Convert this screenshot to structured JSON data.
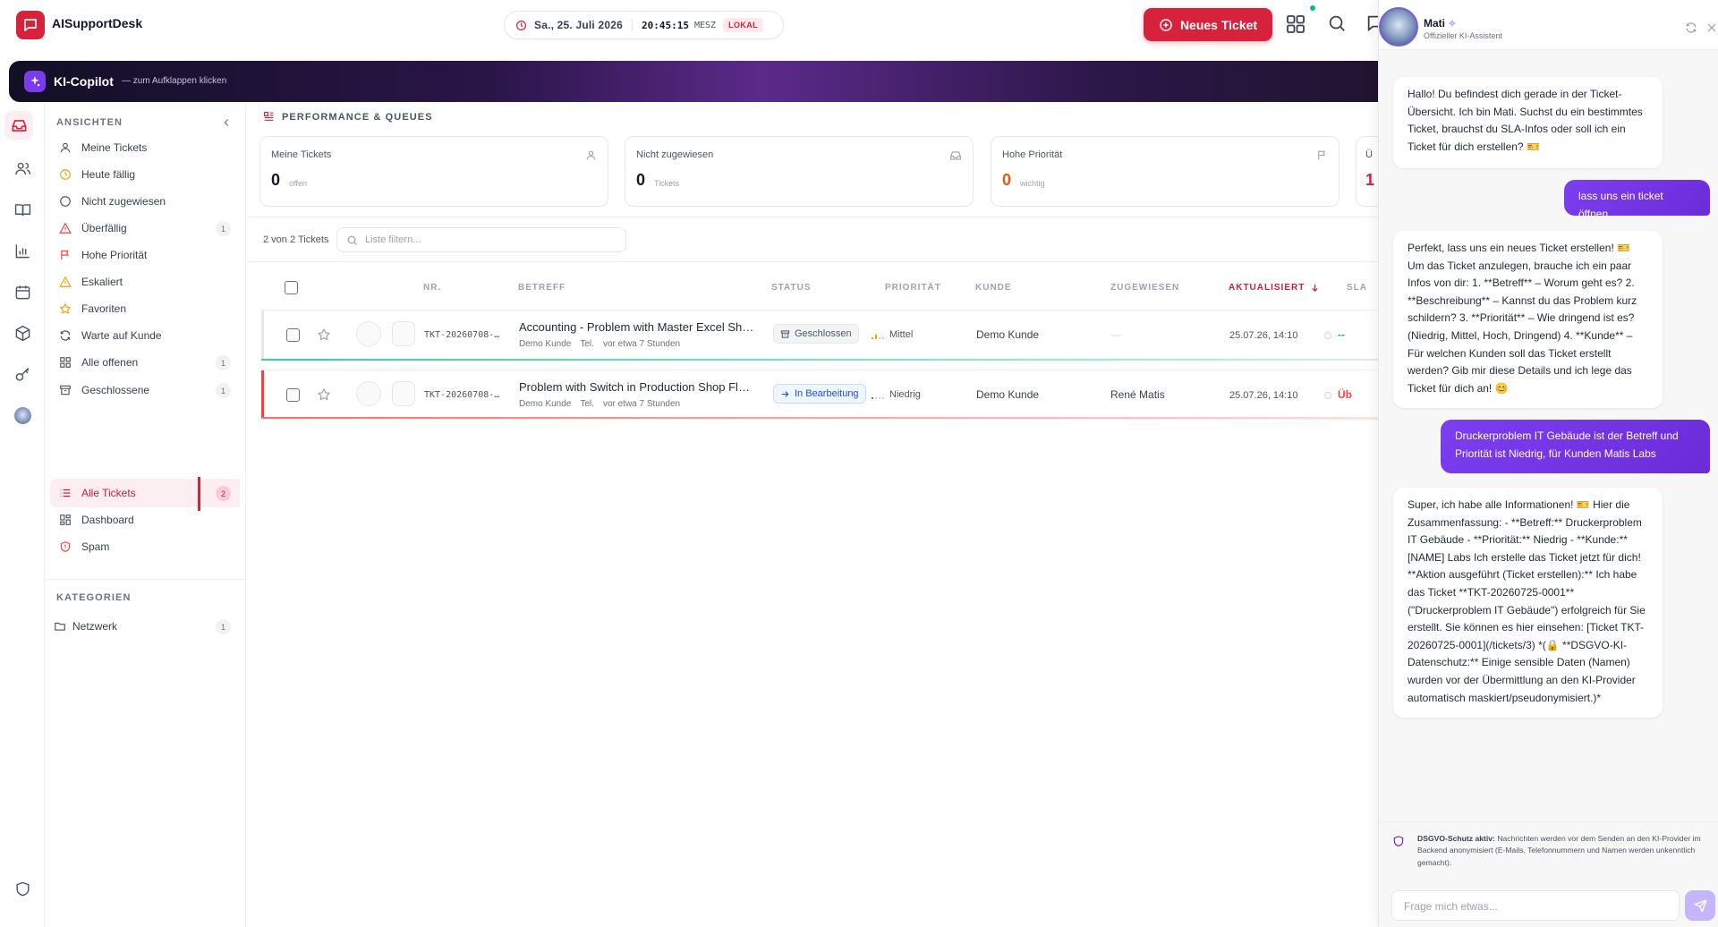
{
  "app": {
    "name": "AISupportDesk"
  },
  "clock": {
    "date": "Sa., 25. Juli 2026",
    "time": "20:45:15",
    "zone": "MESZ",
    "badge": "LOKAL"
  },
  "header": {
    "new_ticket_label": "Neues Ticket"
  },
  "copilot": {
    "title": "KI-Copilot",
    "hint": "— zum Aufklappen klicken"
  },
  "sidebar": {
    "views_heading": "ANSICHTEN",
    "items": [
      {
        "label": "Meine Tickets",
        "count": "",
        "icon": "user-icon"
      },
      {
        "label": "Heute fällig",
        "count": "",
        "icon": "clock-icon"
      },
      {
        "label": "Nicht zugewiesen",
        "count": "",
        "icon": "circle-icon"
      },
      {
        "label": "Überfällig",
        "count": "1",
        "icon": "alert-triangle-icon"
      },
      {
        "label": "Hohe Priorität",
        "count": "",
        "icon": "flag-icon"
      },
      {
        "label": "Eskaliert",
        "count": "",
        "icon": "warning-icon"
      },
      {
        "label": "Favoriten",
        "count": "",
        "icon": "star-icon"
      },
      {
        "label": "Warte auf Kunde",
        "count": "",
        "icon": "refresh-icon"
      },
      {
        "label": "Alle offenen",
        "count": "1",
        "icon": "grid-icon"
      },
      {
        "label": "Geschlossene",
        "count": "1",
        "icon": "archive-icon"
      },
      {
        "label": "Alle Tickets",
        "count": "2",
        "icon": "list-icon",
        "active": true
      },
      {
        "label": "Dashboard",
        "count": "",
        "icon": "dashboard-icon"
      },
      {
        "label": "Spam",
        "count": "",
        "icon": "shield-alert-icon"
      }
    ],
    "categories_heading": "KATEGORIEN",
    "categories": [
      {
        "label": "Netzwerk",
        "count": "1",
        "icon": "folder-icon"
      }
    ]
  },
  "performance": {
    "heading": "PERFORMANCE & QUEUES",
    "cards": [
      {
        "label": "Meine Tickets",
        "value": "0",
        "unit": "offen",
        "icon": "user-icon",
        "value_color": "#111827"
      },
      {
        "label": "Nicht zugewiesen",
        "value": "0",
        "unit": "Tickets",
        "icon": "inbox-icon",
        "value_color": "#111827"
      },
      {
        "label": "Hohe Priorität",
        "value": "0",
        "unit": "wichtig",
        "icon": "flag-icon",
        "value_color": "#ea580c"
      },
      {
        "label": "Ü",
        "value": "1",
        "unit": "",
        "icon": "",
        "value_color": "#d8223b"
      }
    ]
  },
  "list": {
    "count_text": "2 von 2 Tickets",
    "filter_placeholder": "Liste filtern...",
    "columns": [
      "NR.",
      "BETREFF",
      "STATUS",
      "PRIORITÄT",
      "KUNDE",
      "ZUGEWIESEN",
      "AKTUALISIERT",
      "SLA"
    ],
    "sorted_column": "AKTUALISIERT",
    "rows": [
      {
        "nr": "TKT-20260708-…",
        "subject": "Accounting - Problem with Master Excel Sh…",
        "customer_meta": "Demo Kunde",
        "channel": "Tel.",
        "age": "vor etwa 7 Stunden",
        "status": "Geschlossen",
        "status_icon": "archive-icon",
        "priority": "Mittel",
        "customer": "Demo Kunde",
        "assignee": "—",
        "updated": "25.07.26, 14:10",
        "sla": "--",
        "accent": "#10b981"
      },
      {
        "nr": "TKT-20260708-…",
        "subject": "Problem with Switch in Production Shop Fl…",
        "customer_meta": "Demo Kunde",
        "channel": "Tel.",
        "age": "vor etwa 7 Stunden",
        "status": "In Bearbeitung",
        "status_icon": "arrow-right-icon",
        "priority": "Niedrig",
        "customer": "Demo Kunde",
        "assignee": "René Matis",
        "updated": "25.07.26, 14:10",
        "sla": "Üb",
        "accent": "#ef4444"
      }
    ]
  },
  "chat": {
    "name": "Mati",
    "subtitle": "Offizieller KI-Assistent",
    "messages": [
      {
        "role": "bot",
        "text": "Hallo! Du befindest dich gerade in der Ticket-Übersicht. Ich bin Mati. Suchst du ein bestimmtes Ticket, brauchst du SLA-Infos oder soll ich ein Ticket für dich erstellen? 🎫"
      },
      {
        "role": "user",
        "text": "lass uns ein ticket öffnen"
      },
      {
        "role": "bot",
        "text": "Perfekt, lass uns ein neues Ticket erstellen! 🎫 Um das Ticket anzulegen, brauche ich ein paar Infos von dir: 1. **Betreff** – Worum geht es? 2. **Beschreibung** – Kannst du das Problem kurz schildern? 3. **Priorität** – Wie dringend ist es? (Niedrig, Mittel, Hoch, Dringend) 4. **Kunde** – Für welchen Kunden soll das Ticket erstellt werden? Gib mir diese Details und ich lege das Ticket für dich an! 😊"
      },
      {
        "role": "user",
        "text": "Druckerproblem IT Gebäude ist der Betreff und Priorität ist Niedrig, für Kunden Matis Labs"
      },
      {
        "role": "bot",
        "text": "Super, ich habe alle Informationen! 🎫 Hier die Zusammenfassung: - **Betreff:** Druckerproblem IT Gebäude - **Priorität:** Niedrig - **Kunde:** [NAME] Labs Ich erstelle das Ticket jetzt für dich! **Aktion ausgeführt (Ticket erstellen):** Ich habe das Ticket **TKT-20260725-0001** (\"Druckerproblem IT Gebäude\") erfolgreich für Sie erstellt. Sie können es hier einsehen: [Ticket TKT-20260725-0001](/tickets/3) *(🔒 **DSGVO-KI-Datenschutz:** Einige sensible Daten (Namen) wurden vor der Übermittlung an den KI-Provider automatisch maskiert/pseudonymisiert.)*"
      }
    ],
    "privacy_title": "DSGVO-Schutz aktiv:",
    "privacy_text": "Nachrichten werden vor dem Senden an den KI-Provider im Backend anonymisiert (E-Mails, Telefonnummern und Namen werden unkenntlich gemacht).",
    "input_placeholder": "Frage mich etwas..."
  },
  "colors": {
    "brand": "#d8223b",
    "accent_purple": "#7c3aed"
  }
}
